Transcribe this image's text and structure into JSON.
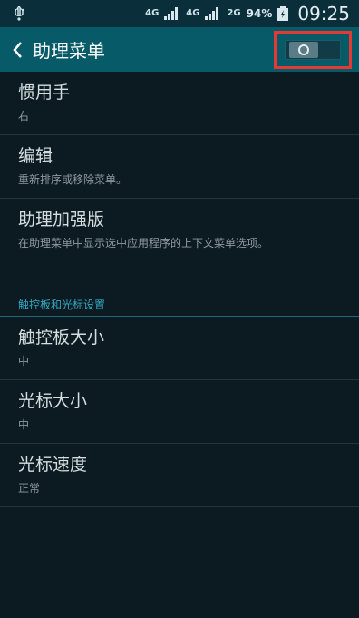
{
  "status_bar": {
    "network_1": "4G",
    "network_2": "4G",
    "network_3": "2G",
    "battery_percent": "94%",
    "time": "09:25"
  },
  "app_bar": {
    "title": "助理菜单",
    "toggle_on": false
  },
  "settings": {
    "handedness": {
      "title": "惯用手",
      "value": "右"
    },
    "edit": {
      "title": "编辑",
      "description": "重新排序或移除菜单。"
    },
    "enhanced": {
      "title": "助理加强版",
      "description": "在助理菜单中显示选中应用程序的上下文菜单选项。"
    },
    "section_touchpad": "触控板和光标设置",
    "touchpad_size": {
      "title": "触控板大小",
      "value": "中"
    },
    "cursor_size": {
      "title": "光标大小",
      "value": "中"
    },
    "cursor_speed": {
      "title": "光标速度",
      "value": "正常"
    }
  },
  "colors": {
    "status_bar_bg": "#0a2f3b",
    "app_bar_bg": "#075a67",
    "content_bg": "#0b1b21",
    "section_header": "#36a7c1",
    "highlight_box": "#e53935"
  }
}
